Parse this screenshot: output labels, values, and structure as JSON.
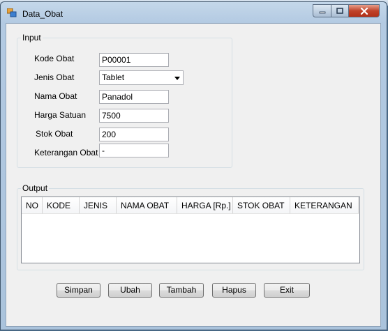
{
  "window": {
    "title": "Data_Obat"
  },
  "input_group": {
    "title": "Input",
    "fields": {
      "kode_obat": {
        "label": "Kode Obat",
        "value": "P00001"
      },
      "jenis_obat": {
        "label": "Jenis Obat",
        "value": "Tablet"
      },
      "nama_obat": {
        "label": "Nama Obat",
        "value": "Panadol"
      },
      "harga_satuan": {
        "label": "Harga Satuan",
        "value": "7500"
      },
      "stok_obat": {
        "label": "Stok Obat",
        "value": "200"
      },
      "keterangan_obat": {
        "label": "Keterangan Obat",
        "value": "-"
      }
    }
  },
  "output_group": {
    "title": "Output",
    "columns": [
      "NO",
      "KODE",
      "JENIS",
      "NAMA OBAT",
      "HARGA [Rp.]",
      "STOK OBAT",
      "KETERANGAN"
    ]
  },
  "buttons": {
    "simpan": "Simpan",
    "ubah": "Ubah",
    "tambah": "Tambah",
    "hapus": "Hapus",
    "exit": "Exit"
  },
  "icons": {
    "app": "form-icon",
    "minimize": "minimize-icon",
    "maximize": "maximize-icon",
    "close": "close-icon"
  },
  "colors": {
    "close_button": "#c0432a",
    "window_frame": "#b3cae2",
    "client_bg": "#f0f0f0"
  }
}
